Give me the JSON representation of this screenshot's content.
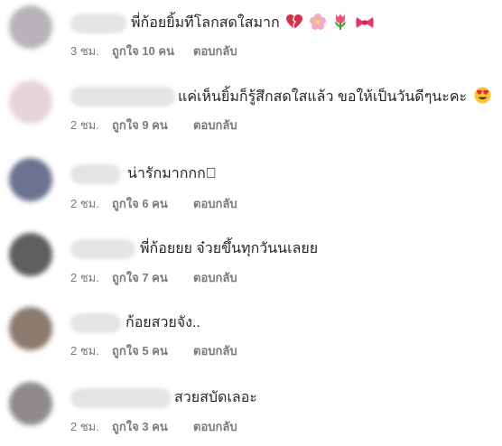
{
  "comments": [
    {
      "text": "พี่ก้อยยิ้มทีโลกสดใสมาก",
      "time": "3 ชม.",
      "likes": "ถูกใจ 10 คน",
      "reply": "ตอบกลับ",
      "avatar_color": "#b7b3b8",
      "emojis": [
        "broken-heart-icon",
        "cherry-blossom-icon",
        "tulip-icon",
        "ribbon-icon"
      ]
    },
    {
      "text": "แค่เห็นยิ้มก็รู้สึกสดใสแล้ว ขอให้เป็นวันดีๆนะคะ",
      "time": "2 ชม.",
      "likes": "ถูกใจ 9 คน",
      "reply": "ตอบกลับ",
      "avatar_color": "#e6d4dc",
      "emojis": [
        "heart-eyes-icon"
      ]
    },
    {
      "text": "น่ารักมากกก􀄂",
      "time": "2 ชม.",
      "likes": "ถูกใจ 6 คน",
      "reply": "ตอบกลับ",
      "avatar_color": "#6c7390",
      "emojis": []
    },
    {
      "text": "พี่ก้อยยย จ๋วยขึ้นทุกวันนเลยย",
      "time": "2 ชม.",
      "likes": "ถูกใจ 7 คน",
      "reply": "ตอบกลับ",
      "avatar_color": "#5e5e60",
      "emojis": []
    },
    {
      "text": "ก้อยสวยจัง..",
      "time": "2 ชม.",
      "likes": "ถูกใจ 5 คน",
      "reply": "ตอบกลับ",
      "avatar_color": "#8b7a6e",
      "emojis": []
    },
    {
      "text": "สวยสบัดเลอะ",
      "time": "2 ชม.",
      "likes": "ถูกใจ 3 คน",
      "reply": "ตอบกลับ",
      "avatar_color": "#8f8a8d",
      "emojis": []
    }
  ],
  "colors": {
    "text": "#262626",
    "meta": "#7a7a7a",
    "blurred_username": "#e4e4e7"
  }
}
